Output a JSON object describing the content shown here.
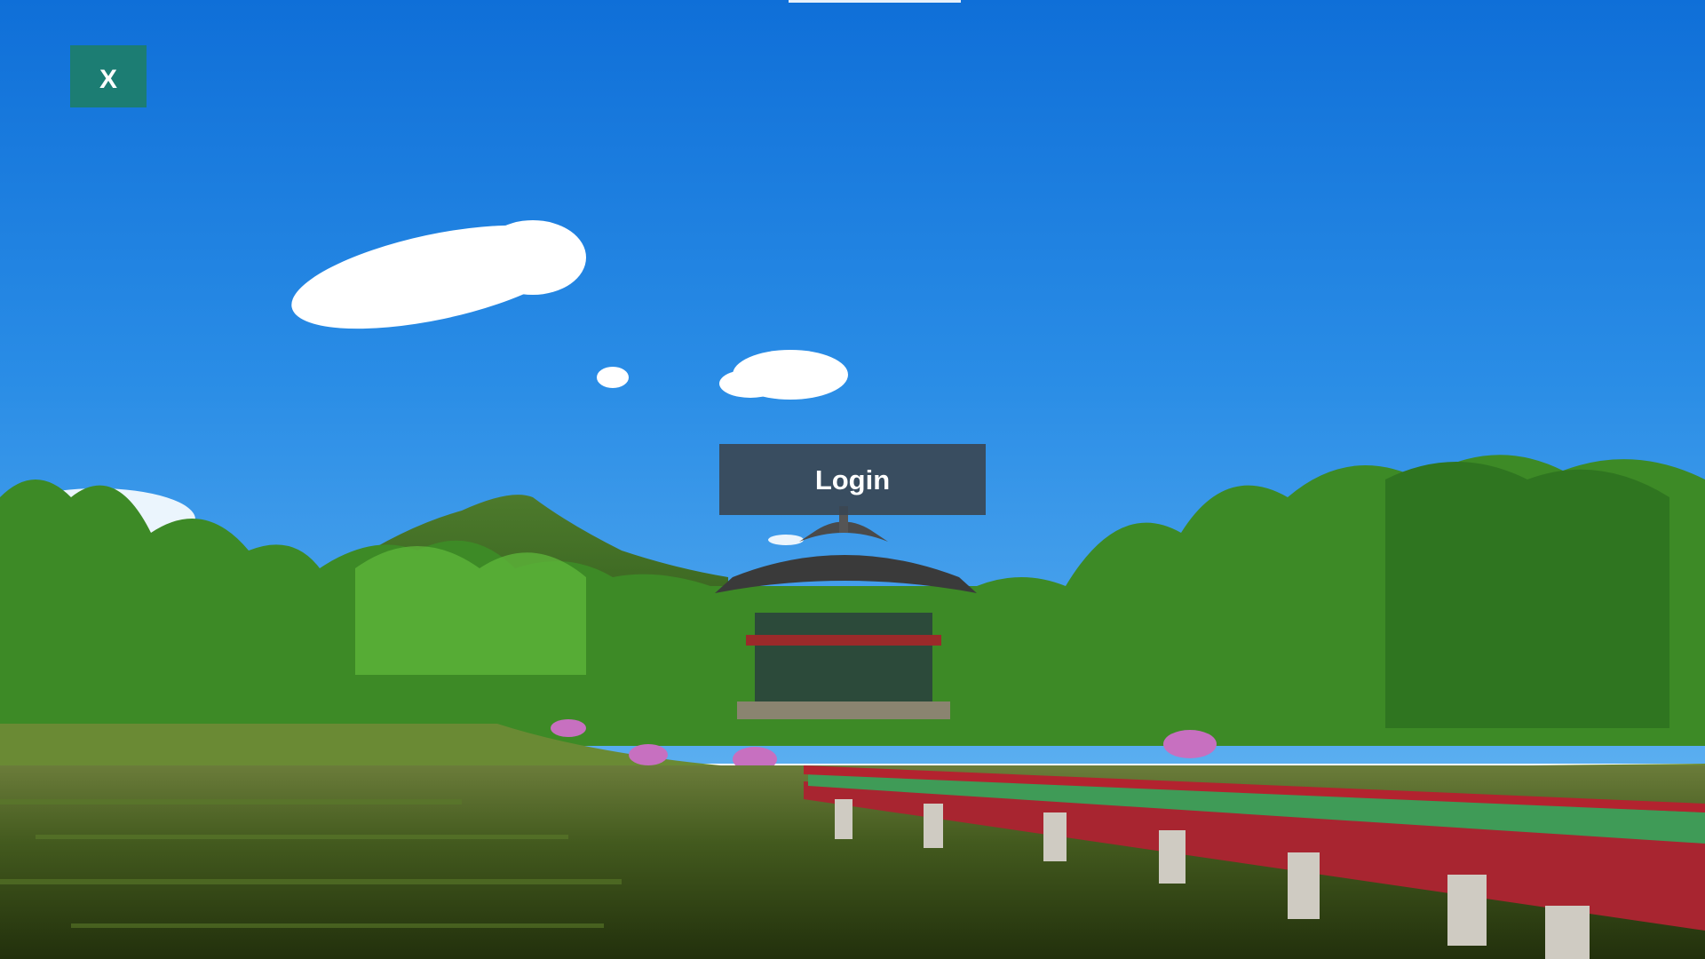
{
  "close_button": {
    "label": "X",
    "color": "#1c7d73"
  },
  "login_button": {
    "label": "Login",
    "color": "#3a4654"
  },
  "background": {
    "icon": "landscape-photo",
    "sky_color": "#1b7ee0",
    "bridge_color": "#b3232f",
    "foliage_color": "#3f9a2a",
    "water_color": "#3f5a1f"
  }
}
